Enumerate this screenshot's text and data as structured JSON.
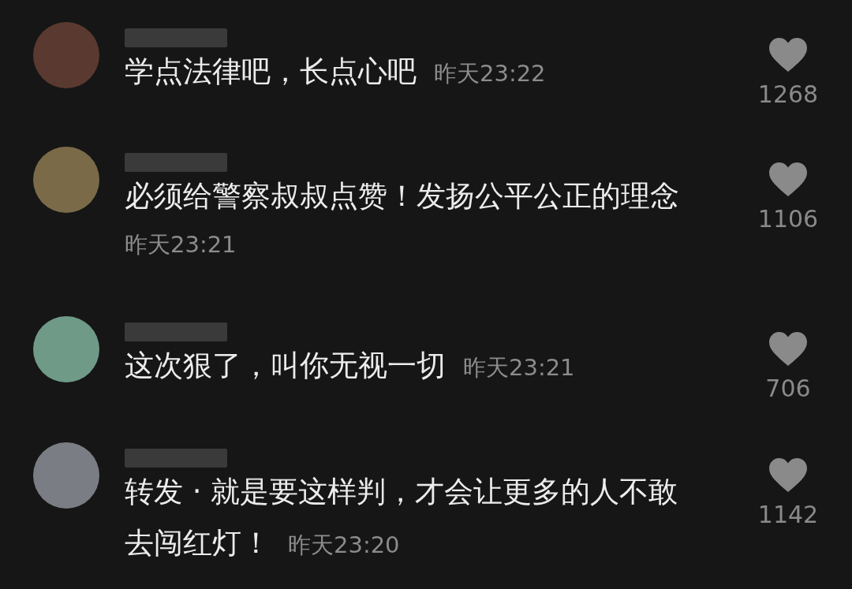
{
  "comments": [
    {
      "lines": [
        "学点法律吧，长点心吧"
      ],
      "time": "昨天23:22",
      "likes": "1268",
      "liked": false
    },
    {
      "lines": [
        "必须给警察叔叔点赞！发扬公平公正的理念"
      ],
      "time": "昨天23:21",
      "likes": "1106",
      "liked": false
    },
    {
      "lines": [
        "这次狠了，叫你无视一切"
      ],
      "time": "昨天23:21",
      "likes": "706",
      "liked": false
    },
    {
      "lines": [
        "转发 · 就是要这样判，才会让更多的人不敢",
        "去闯红灯！"
      ],
      "time": "昨天23:20",
      "likes": "1142",
      "liked": false
    }
  ]
}
